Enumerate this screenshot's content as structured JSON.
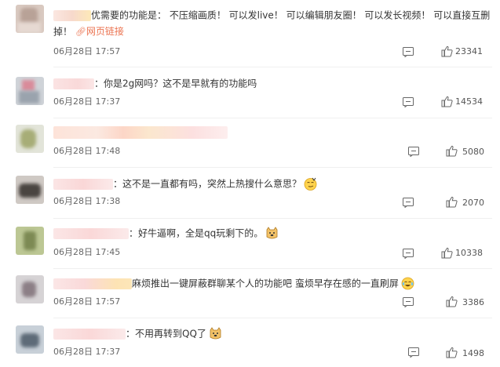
{
  "comments": [
    {
      "prefix": "",
      "text": "优需要的功能是： 不压缩画质！ 可以发live！ 可以编辑朋友圈！ 可以发长视频！ 可以直接互删掉！",
      "link": "网页链接",
      "time": "06月28日 17:57",
      "likes": "23341"
    },
    {
      "prefix": "",
      "text": "：你是2g网吗？这不是早就有的功能吗",
      "time": "06月28日 17:37",
      "likes": "14534"
    },
    {
      "prefix": "",
      "text": "",
      "time": "06月28日 17:48",
      "likes": "5080"
    },
    {
      "prefix": "",
      "text": "：这不是一直都有吗，突然上热搜什么意思？",
      "time": "06月28日 17:38",
      "likes": "2070",
      "emoji": "smirk-emoji"
    },
    {
      "prefix": "",
      "text": "：好牛逼啊，全是qq玩剩下的。",
      "time": "06月28日 17:45",
      "likes": "10338",
      "emoji": "doge-emoji"
    },
    {
      "prefix": "",
      "text": "麻烦推出一键屏蔽群聊某个人的功能吧 蛮烦早存在感的一直刷屏",
      "time": "06月28日 17:57",
      "likes": "3386",
      "emoji": "tears-emoji"
    },
    {
      "prefix": "",
      "text": "：不用再转到QQ了",
      "time": "06月28日 17:37",
      "likes": "1498",
      "emoji": "doge-emoji"
    }
  ],
  "icons": {
    "reply": "comment-icon",
    "like": "thumbs-up-icon",
    "link": "link-icon"
  },
  "colors": {
    "link": "#eb7350",
    "text": "#333333",
    "meta": "#666666"
  }
}
